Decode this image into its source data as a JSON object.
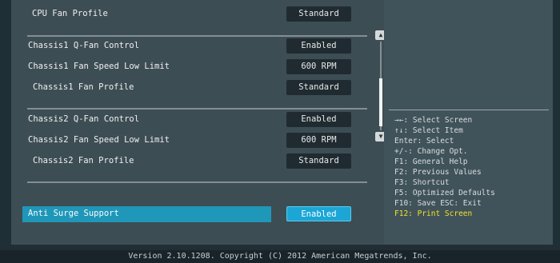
{
  "settings": [
    {
      "label": "CPU Fan Profile",
      "value": "Standard"
    },
    {
      "label": "Chassis1 Q-Fan Control",
      "value": "Enabled"
    },
    {
      "label": "Chassis1 Fan Speed Low Limit",
      "value": "600 RPM"
    },
    {
      "label": "Chassis1 Fan Profile",
      "value": "Standard"
    },
    {
      "label": "Chassis2 Q-Fan Control",
      "value": "Enabled"
    },
    {
      "label": "Chassis2 Fan Speed Low Limit",
      "value": "600 RPM"
    },
    {
      "label": "Chassis2 Fan Profile",
      "value": "Standard"
    },
    {
      "label": "Anti Surge Support",
      "value": "Enabled"
    }
  ],
  "help": [
    "→←: Select Screen",
    "↑↓: Select Item",
    "Enter: Select",
    "+/-: Change Opt.",
    "F1: General Help",
    "F2: Previous Values",
    "F3: Shortcut",
    "F5: Optimized Defaults",
    "F10: Save  ESC: Exit",
    "F12: Print Screen"
  ],
  "footer": "Version 2.10.1208. Copyright (C) 2012 American Megatrends, Inc.",
  "scrollbar": {
    "up_glyph": "▲",
    "down_glyph": "▼"
  },
  "colors": {
    "highlight": "#1f97b9",
    "accent_help": "#f2e22a"
  }
}
